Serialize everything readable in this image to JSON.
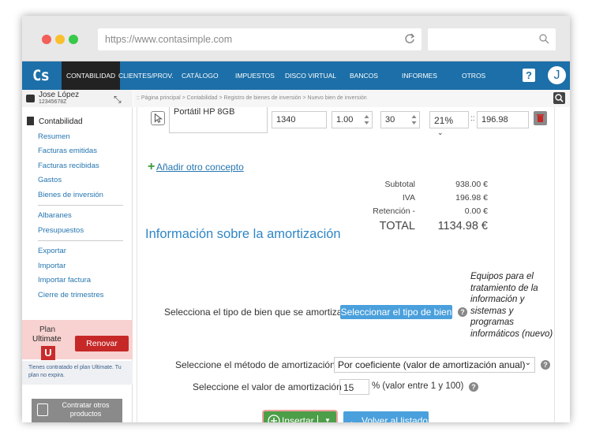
{
  "browser": {
    "url": "https://www.contasimple.com"
  },
  "nav": {
    "logo": "Cs",
    "items": [
      "CONTABILIDAD",
      "CLIENTES/PROV.",
      "CATÁLOGO",
      "IMPUESTOS",
      "DISCO VIRTUAL",
      "BANCOS",
      "INFORMES",
      "OTROS"
    ],
    "help": "?",
    "avatar": "J",
    "accent": "#1c6fa8"
  },
  "user": {
    "name": "Jose López",
    "id": "12345678Z"
  },
  "sidebar": {
    "section": "Contabilidad",
    "group1": [
      "Resumen",
      "Facturas emitidas",
      "Facturas recibidas",
      "Gastos",
      "Bienes de inversión"
    ],
    "group2": [
      "Albaranes",
      "Presupuestos"
    ],
    "group3": [
      "Exportar",
      "Importar",
      "Importar factura",
      "Cierre de trimestres"
    ]
  },
  "plan": {
    "label": "Plan",
    "name": "Ultimate",
    "badge": "U",
    "renew": "Renovar",
    "note": "Tienes contratado el plan Ultimate. Tu plan no expira.",
    "contract": "Contratar otros productos"
  },
  "breadcrumb": ":: Página principal > Contabilidad > Registro de bienes de inversión > Nuevo bien de inversión",
  "line": {
    "description": "Portátil HP 8GB",
    "amount": "1340",
    "quantity": "1.00",
    "discount": "30",
    "vat": "21%",
    "vat_sep": "::",
    "vat_amount": "196.98"
  },
  "add_concept": "Añadir otro concepto",
  "totals": {
    "subtotal_label": "Subtotal",
    "subtotal": "938.00 €",
    "iva_label": "IVA",
    "iva": "196.98 €",
    "retention_label": "Retención -",
    "retention": "0.00 €",
    "total_label": "TOTAL",
    "total": "1134.98 €"
  },
  "amortization": {
    "title": "Información sobre la amortización",
    "type_label": "Selecciona el tipo de bien que se amortiza",
    "type_button": "Seleccionar el tipo de bien",
    "type_selected": "Equipos para el tratamiento de la información y sistemas y programas informáticos (nuevo)",
    "method_label": "Seleccione el método de amortización",
    "method_value": "Por coeficiente (valor de amortización anual)",
    "value_label": "Seleccione el valor de amortización",
    "value": "15",
    "value_hint": "% (valor entre 1 y 100)"
  },
  "actions": {
    "insert": "Insertar",
    "back": "Volver al listado"
  }
}
